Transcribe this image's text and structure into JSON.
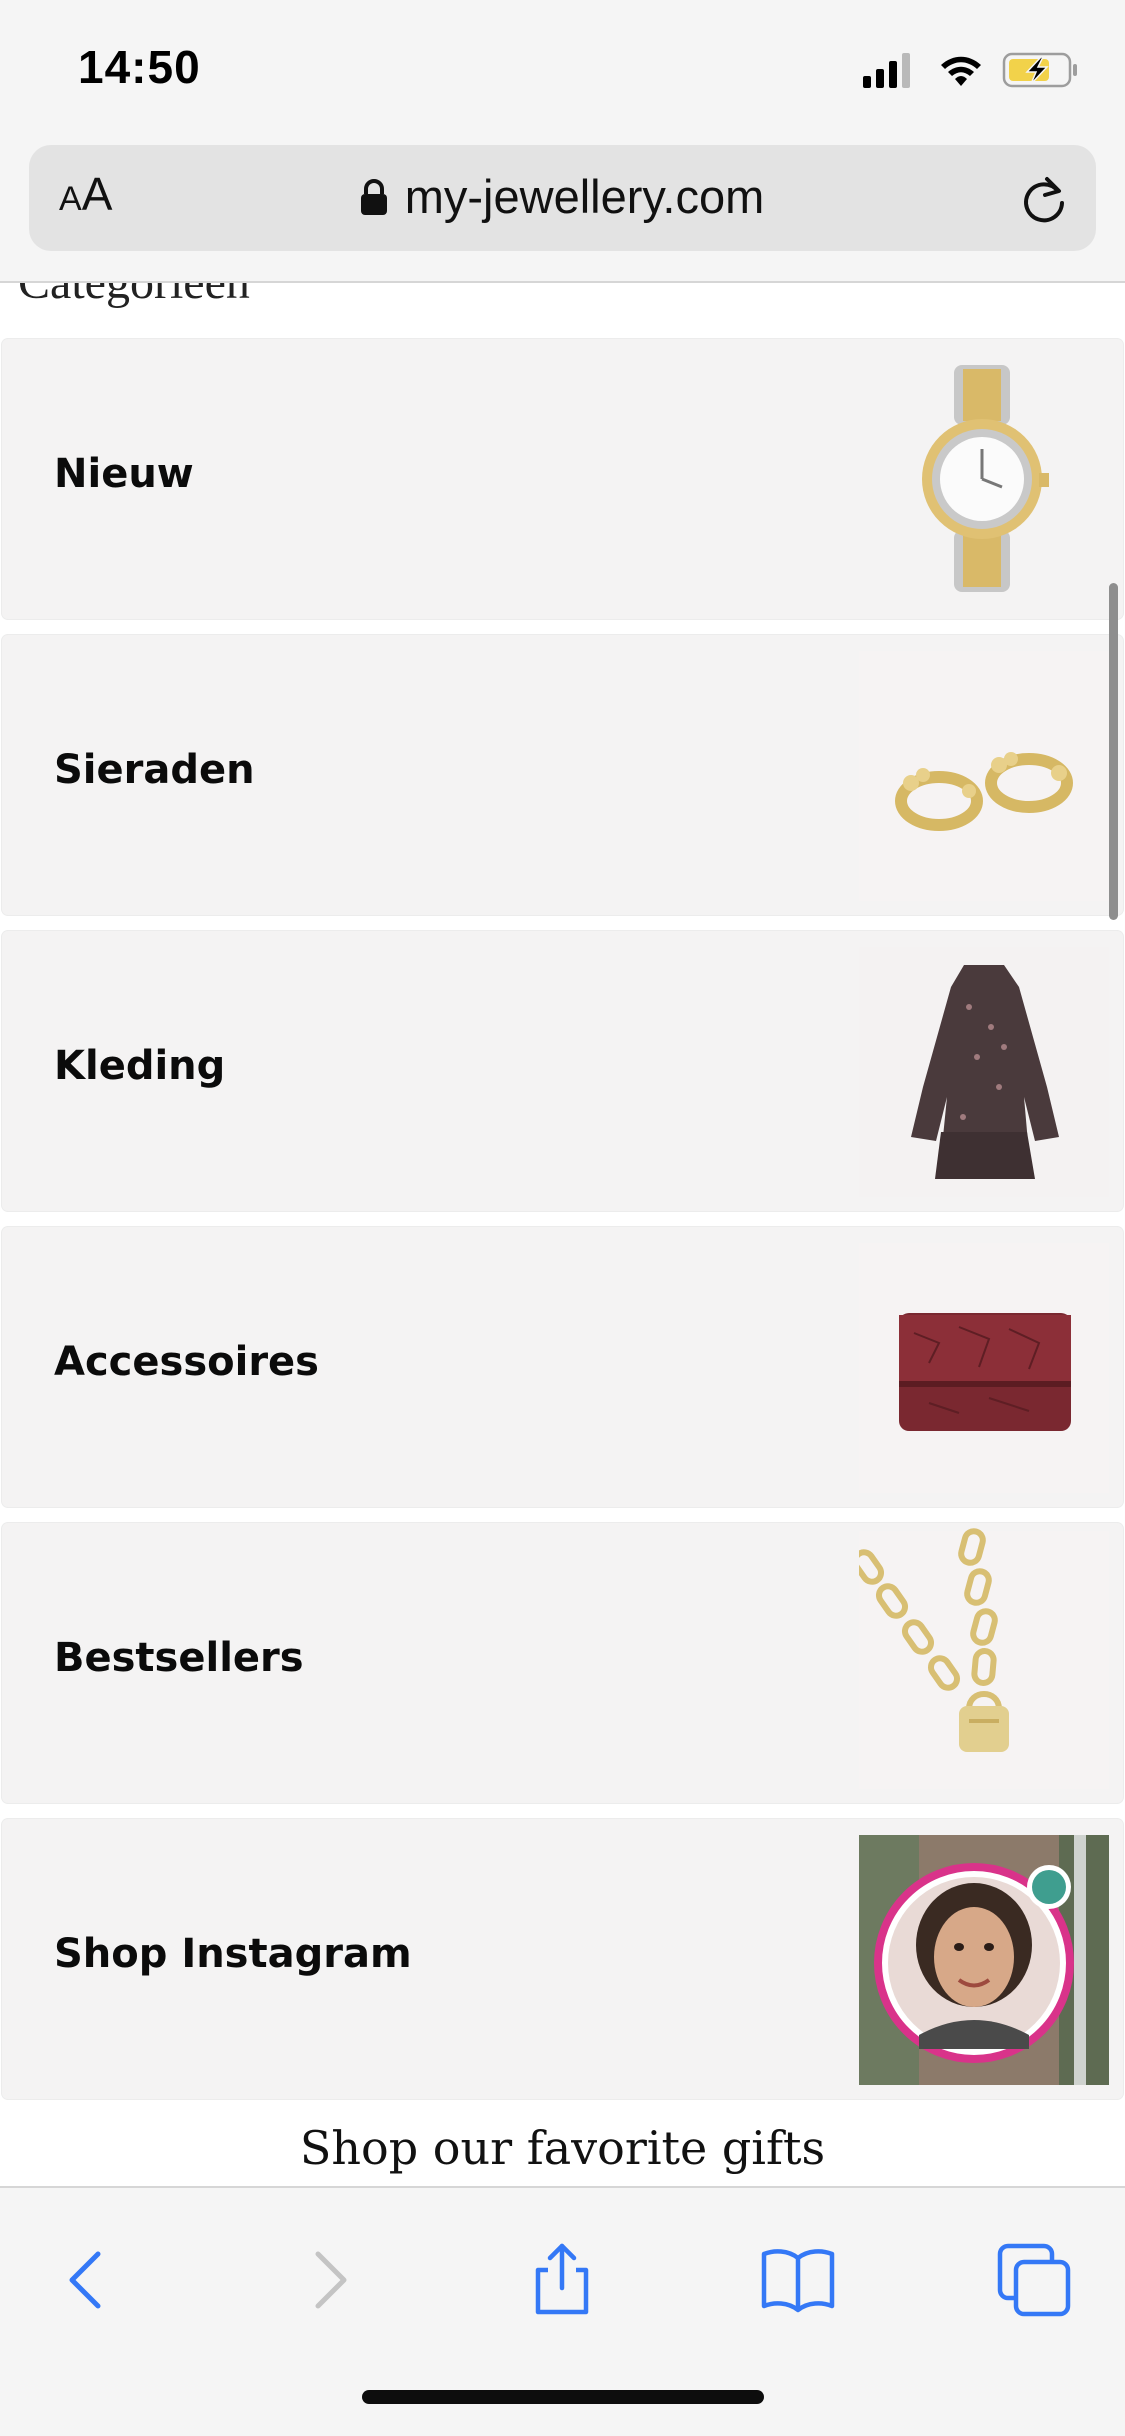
{
  "status_bar": {
    "time": "14:50",
    "battery_color": "#f2d24a"
  },
  "browser": {
    "text_size_label_small": "A",
    "text_size_label_large": "A",
    "url": "my-jewellery.com",
    "accent": "#3478f6"
  },
  "page": {
    "section_title": "Categorieën",
    "categories": [
      {
        "label": "Nieuw",
        "thumb_icon": "watch-image"
      },
      {
        "label": "Sieraden",
        "thumb_icon": "earrings-image"
      },
      {
        "label": "Kleding",
        "thumb_icon": "dress-image"
      },
      {
        "label": "Accessoires",
        "thumb_icon": "bag-image"
      },
      {
        "label": "Bestsellers",
        "thumb_icon": "necklace-image"
      },
      {
        "label": "Shop Instagram",
        "thumb_icon": "instagram-avatar-image"
      }
    ],
    "favorites_heading": "Shop our favorite gifts",
    "instagram_ring_color": "#d9338a",
    "online_dot_color": "#3f9e8f"
  },
  "toolbar": {
    "items": [
      {
        "icon": "back-icon",
        "enabled": true
      },
      {
        "icon": "forward-icon",
        "enabled": false
      },
      {
        "icon": "share-icon",
        "enabled": true
      },
      {
        "icon": "bookmarks-icon",
        "enabled": true
      },
      {
        "icon": "tabs-icon",
        "enabled": true
      }
    ]
  }
}
